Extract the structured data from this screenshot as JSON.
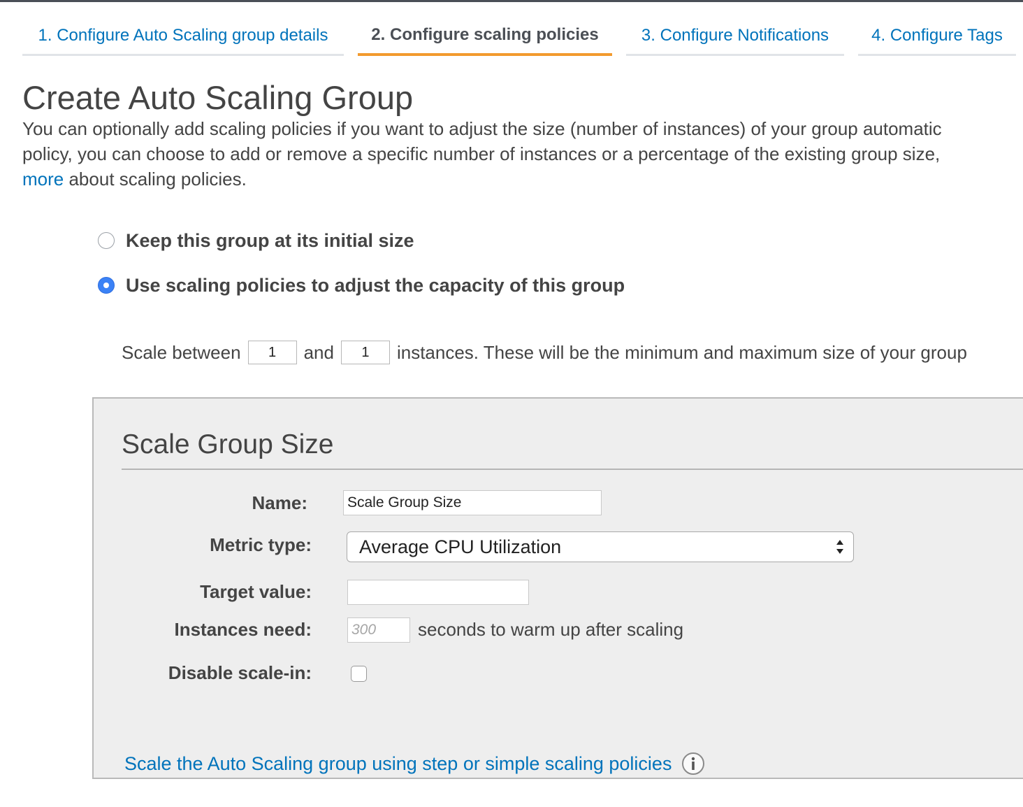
{
  "wizard": {
    "tabs": [
      {
        "label": "1. Configure Auto Scaling group details",
        "active": false
      },
      {
        "label": "2. Configure scaling policies",
        "active": true
      },
      {
        "label": "3. Configure Notifications",
        "active": false
      },
      {
        "label": "4. Configure Tags",
        "active": false
      }
    ]
  },
  "page": {
    "title": "Create Auto Scaling Group",
    "description": {
      "line1": "You can optionally add scaling policies if you want to adjust the size (number of instances) of your group automatic",
      "line2": "policy, you can choose to add or remove a specific number of instances or a percentage of the existing group size,",
      "link": "more",
      "line3_rest": " about scaling policies."
    }
  },
  "options": {
    "keep_initial": {
      "label": "Keep this group at its initial size",
      "selected": false
    },
    "use_policies": {
      "label": "Use scaling policies to adjust the capacity of this group",
      "selected": true
    }
  },
  "scale_between": {
    "prefix": "Scale between",
    "min": "1",
    "and": "and",
    "max": "1",
    "suffix": "instances. These will be the minimum and maximum size of your group"
  },
  "policy": {
    "title": "Scale Group Size",
    "name_label": "Name:",
    "name_value": "Scale Group Size",
    "metric_label": "Metric type:",
    "metric_value": "Average CPU Utilization",
    "target_label": "Target value:",
    "target_value": "",
    "warmup_label": "Instances need:",
    "warmup_placeholder": "300",
    "warmup_suffix": "seconds to warm up after scaling",
    "disable_label": "Disable scale-in:",
    "disable_checked": false
  },
  "footer_link": {
    "label": "Scale the Auto Scaling group using step or simple scaling policies",
    "icon": "info-icon"
  },
  "colors": {
    "link": "#0073bb",
    "active_tab": "#f29a2e",
    "radio_selected": "#3b82f6"
  }
}
